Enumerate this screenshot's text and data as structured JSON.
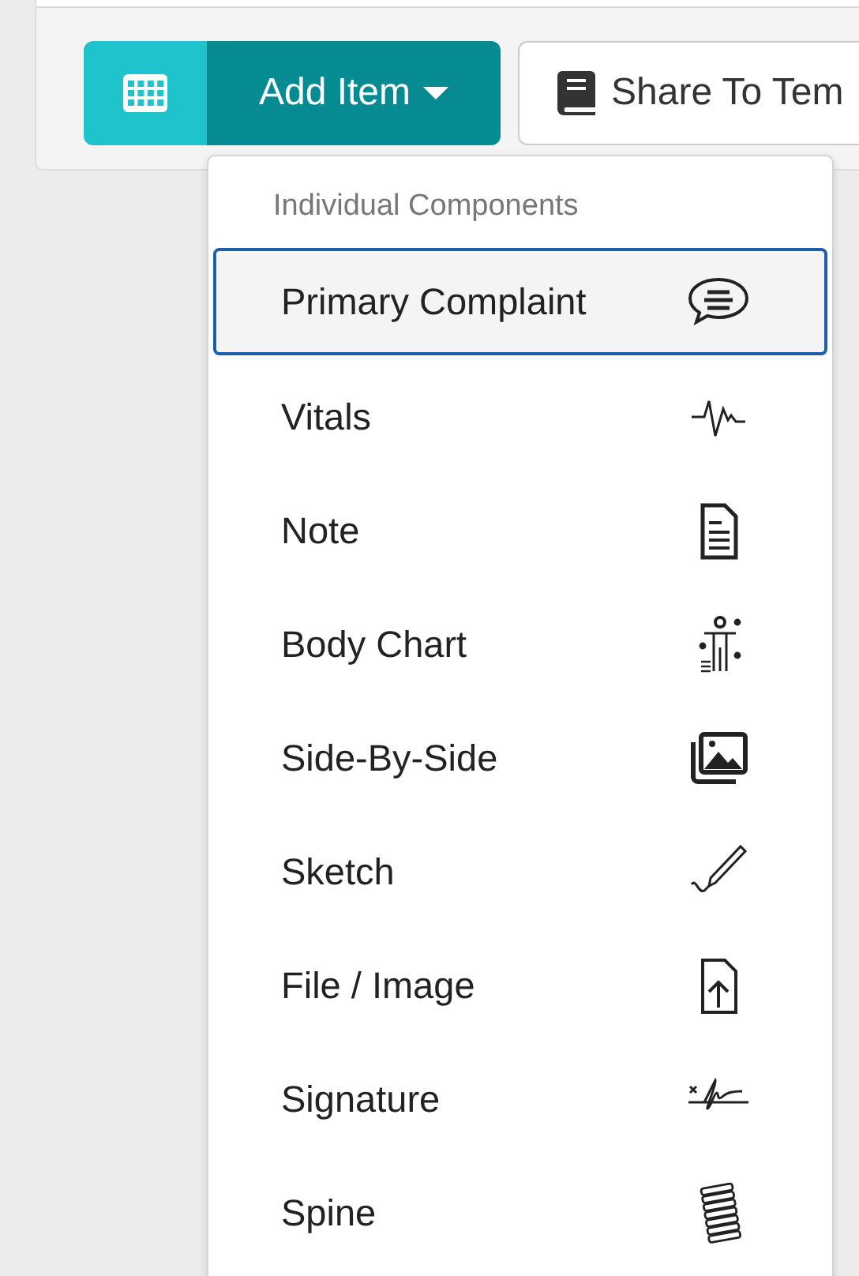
{
  "toolbar": {
    "add_item": {
      "label": "Add Item",
      "expanded": true
    },
    "share": {
      "label": "Share To Tem"
    }
  },
  "menu": {
    "header": "Individual Components",
    "items": [
      {
        "label": "Primary Complaint",
        "selected": true
      },
      {
        "label": "Vitals",
        "selected": false
      },
      {
        "label": "Note",
        "selected": false
      },
      {
        "label": "Body Chart",
        "selected": false
      },
      {
        "label": "Side-By-Side",
        "selected": false
      },
      {
        "label": "Sketch",
        "selected": false
      },
      {
        "label": "File / Image",
        "selected": false
      },
      {
        "label": "Signature",
        "selected": false
      },
      {
        "label": "Spine",
        "selected": false
      }
    ]
  }
}
